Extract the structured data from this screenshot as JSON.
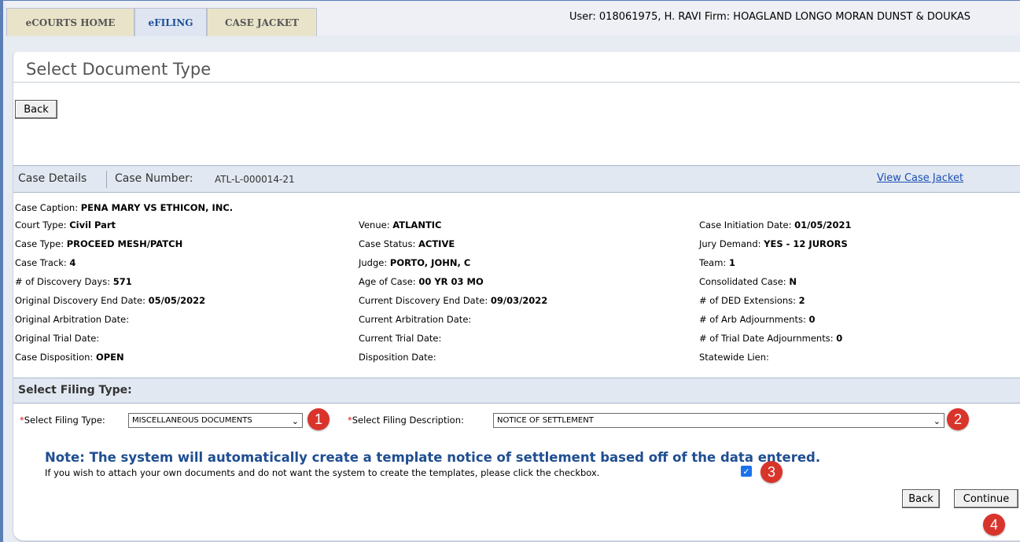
{
  "nav": {
    "tabs": [
      {
        "label": "eCOURTS HOME"
      },
      {
        "label": "eFILING"
      },
      {
        "label": "CASE JACKET"
      }
    ],
    "user_info": "User: 018061975, H. RAVI  Firm: HOAGLAND LONGO MORAN DUNST & DOUKAS"
  },
  "page": {
    "title": "Select Document Type",
    "back_label": "Back"
  },
  "case": {
    "details_label": "Case Details",
    "number_label": "Case Number:",
    "number_value": "ATL-L-000014-21",
    "view_jacket": "View Case Jacket",
    "caption_label": "Case Caption:",
    "caption_value": "PENA MARY VS ETHICON, INC.",
    "fields": {
      "court_type": {
        "label": "Court Type:",
        "value": "Civil Part"
      },
      "venue": {
        "label": "Venue:",
        "value": "ATLANTIC"
      },
      "initiation_date": {
        "label": "Case Initiation Date:",
        "value": "01/05/2021"
      },
      "case_type": {
        "label": "Case Type:",
        "value": "PROCEED MESH/PATCH"
      },
      "case_status": {
        "label": "Case Status:",
        "value": "ACTIVE"
      },
      "jury_demand": {
        "label": "Jury Demand:",
        "value": "YES - 12 JURORS"
      },
      "case_track": {
        "label": "Case Track:",
        "value": "4"
      },
      "judge": {
        "label": "Judge:",
        "value": "PORTO, JOHN, C"
      },
      "team": {
        "label": "Team:",
        "value": "1"
      },
      "discovery_days": {
        "label": "# of Discovery Days:",
        "value": "571"
      },
      "age_of_case": {
        "label": "Age of Case:",
        "value": "00 YR 03 MO"
      },
      "consolidated": {
        "label": "Consolidated Case:",
        "value": "N"
      },
      "orig_discovery_end": {
        "label": "Original Discovery End Date:",
        "value": "05/05/2022"
      },
      "curr_discovery_end": {
        "label": "Current Discovery End Date:",
        "value": "09/03/2022"
      },
      "ded_extensions": {
        "label": "# of DED Extensions:",
        "value": "2"
      },
      "orig_arbitration": {
        "label": "Original Arbitration Date:",
        "value": ""
      },
      "curr_arbitration": {
        "label": "Current Arbitration Date:",
        "value": ""
      },
      "arb_adjournments": {
        "label": "# of Arb Adjournments:",
        "value": "0"
      },
      "orig_trial": {
        "label": "Original Trial Date:",
        "value": ""
      },
      "curr_trial": {
        "label": "Current Trial Date:",
        "value": ""
      },
      "trial_adjournments": {
        "label": "# of Trial Date Adjournments:",
        "value": "0"
      },
      "disposition": {
        "label": "Case Disposition:",
        "value": "OPEN"
      },
      "disposition_date": {
        "label": "Disposition Date:",
        "value": ""
      },
      "statewide_lien": {
        "label": "Statewide Lien:",
        "value": ""
      }
    }
  },
  "filing": {
    "section_label": "Select Filing Type:",
    "type_label": "Select Filing Type:",
    "type_value": "MISCELLANEOUS DOCUMENTS",
    "desc_label": "Select Filing Description:",
    "desc_value": "NOTICE OF SETTLEMENT",
    "required_mark": "*",
    "note_title": "Note: The system will automatically create a template notice of settlement based off of the data entered.",
    "note_text": "If you wish to attach your own documents and do not want the system to create the templates, please click the checkbox.",
    "checkbox_checked": true,
    "back_label": "Back",
    "continue_label": "Continue"
  },
  "callouts": [
    "1",
    "2",
    "3",
    "4"
  ],
  "colors": {
    "accent": "#1f4e91",
    "callout": "#d9342b",
    "link": "#1a4fb5",
    "section_bar": "#e2e8f1"
  }
}
